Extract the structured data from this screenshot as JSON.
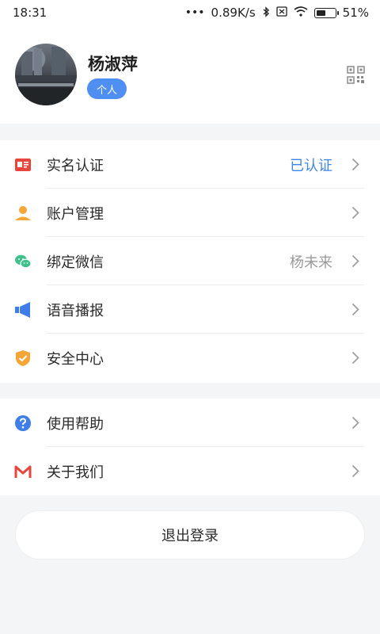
{
  "status_bar": {
    "time": "18:31",
    "dots": "•••",
    "speed": "0.89K/s",
    "battery": "51%",
    "battery_level": 0.51
  },
  "profile": {
    "name": "杨淑萍",
    "badge": "个人"
  },
  "menu_group_1": [
    {
      "label": "实名认证",
      "value": "已认证",
      "icon": "id-card-icon",
      "color": "#e8453c"
    },
    {
      "label": "账户管理",
      "value": "",
      "icon": "person-icon",
      "color": "#f4a637"
    },
    {
      "label": "绑定微信",
      "value": "杨未来",
      "icon": "wechat-icon",
      "color": "#3cc28a"
    },
    {
      "label": "语音播报",
      "value": "",
      "icon": "megaphone-icon",
      "color": "#3f7ee8"
    },
    {
      "label": "安全中心",
      "value": "",
      "icon": "shield-icon",
      "color": "#f4a637"
    }
  ],
  "menu_group_2": [
    {
      "label": "使用帮助",
      "value": "",
      "icon": "help-icon",
      "color": "#3f7ee8"
    },
    {
      "label": "关于我们",
      "value": "",
      "icon": "m-logo-icon",
      "color": "#e8453c"
    }
  ],
  "logout_label": "退出登录",
  "colors": {
    "accent": "#4f8ff2",
    "verified_text": "#3f86e8",
    "page_bg": "#f4f5f7"
  }
}
